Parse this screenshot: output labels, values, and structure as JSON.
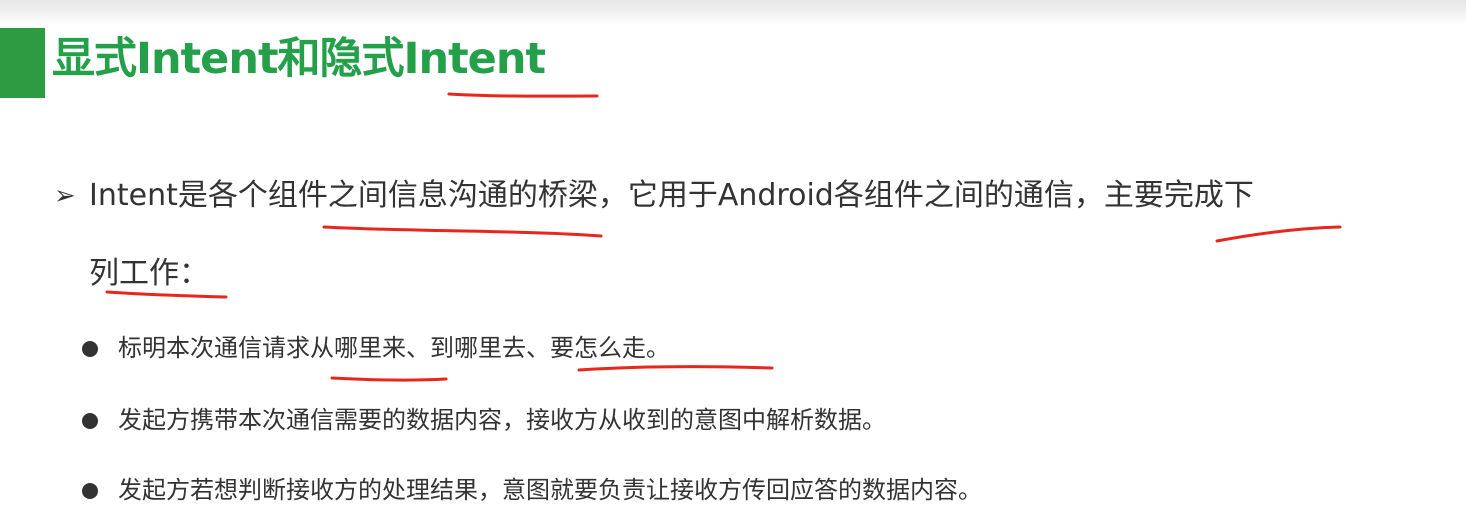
{
  "title": "显式Intent和隐式Intent",
  "lead": {
    "arrow": "➢",
    "line1": "Intent是各个组件之间信息沟通的桥梁，它用于Android各组件之间的通信，主要完成下",
    "line2": "列工作："
  },
  "bullets": [
    "标明本次通信请求从哪里来、到哪里去、要怎么走。",
    "发起方携带本次通信需要的数据内容，接收方从收到的意图中解析数据。",
    "发起方若想判断接收方的处理结果，意图就要负责让接收方传回应答的数据内容。"
  ],
  "colors": {
    "title_green": "#24a04a",
    "title_bar": "#2e9b43",
    "annotation_red": "#e8261b",
    "body_text": "#333333"
  }
}
